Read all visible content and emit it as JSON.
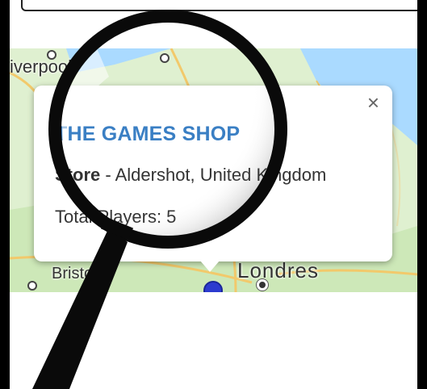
{
  "map": {
    "labels": {
      "liverpool": "iverpool",
      "bristol": "Bristol",
      "londres": "Londres"
    },
    "marker_color": "#2c3bcf"
  },
  "popup": {
    "close_symbol": "×",
    "title": "THE GAMES SHOP",
    "store_type": "Store",
    "separator": " - ",
    "location": "Aldershot, United Kingdom",
    "players_label": "Total Players: 5",
    "title_color": "#3a7fc4"
  },
  "overlay": {
    "icon": "magnifying-glass-icon"
  }
}
